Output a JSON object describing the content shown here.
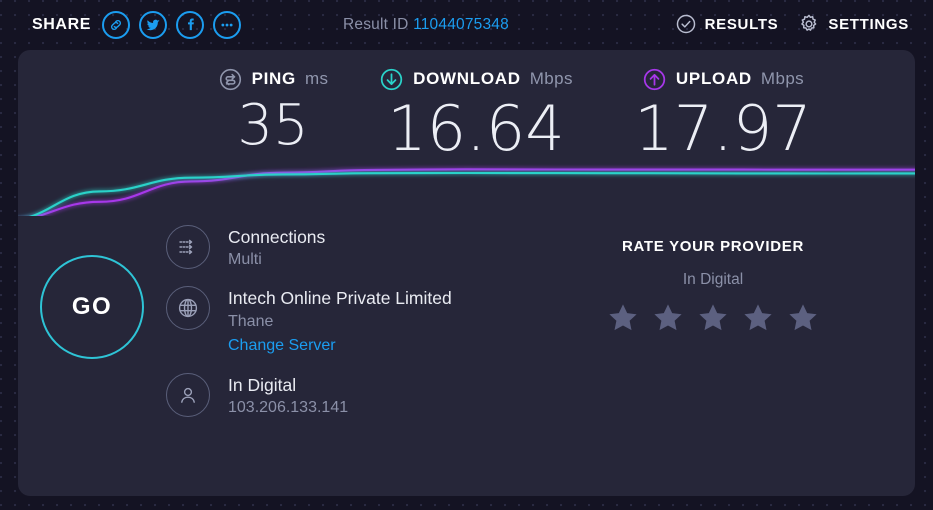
{
  "header": {
    "share_label": "SHARE",
    "share_buttons": [
      {
        "name": "link-icon",
        "title": "Copy link"
      },
      {
        "name": "twitter-icon",
        "title": "Twitter"
      },
      {
        "name": "facebook-icon",
        "title": "Facebook"
      },
      {
        "name": "more-icon",
        "title": "More"
      }
    ],
    "result_id_label": "Result ID",
    "result_id_value": "11044075348",
    "results_label": "RESULTS",
    "settings_label": "SETTINGS"
  },
  "metrics": {
    "ping": {
      "name": "PING",
      "unit": "ms",
      "value": "35",
      "icon": "ping-icon",
      "color": "#9096ad"
    },
    "download": {
      "name": "DOWNLOAD",
      "unit": "Mbps",
      "value": "16.64",
      "icon": "download-icon",
      "color": "#2ad2c9"
    },
    "upload": {
      "name": "UPLOAD",
      "unit": "Mbps",
      "value": "17.97",
      "icon": "upload-icon",
      "color": "#a737ea"
    }
  },
  "chart_data": {
    "type": "line",
    "title": "",
    "xlabel": "",
    "ylabel": "",
    "grid": false,
    "legend": "none",
    "series": [
      {
        "name": "Download",
        "color": "#2ad2c9",
        "values": [
          0,
          10.2,
          15.1,
          16.3,
          16.7,
          16.8,
          16.75,
          16.7,
          16.65,
          16.6,
          16.64
        ]
      },
      {
        "name": "Upload",
        "color": "#a737ea",
        "values": [
          0,
          6.5,
          13.8,
          16.9,
          17.9,
          18.1,
          18.05,
          18.0,
          17.99,
          17.98,
          17.97
        ]
      }
    ],
    "x": [
      0,
      1,
      2,
      3,
      4,
      5,
      6,
      7,
      8,
      9,
      10
    ],
    "ylim": [
      0,
      20
    ]
  },
  "test": {
    "go_label": "GO"
  },
  "connection": {
    "rows": [
      {
        "icon": "connections-icon",
        "title": "Connections",
        "sub": "Multi",
        "link": ""
      },
      {
        "icon": "globe-icon",
        "title": "Intech Online Private Limited",
        "sub": "Thane",
        "link": "Change Server"
      },
      {
        "icon": "person-icon",
        "title": "In Digital",
        "sub": "103.206.133.141",
        "link": ""
      }
    ]
  },
  "rating": {
    "title": "RATE YOUR PROVIDER",
    "provider": "In Digital",
    "stars_total": 5,
    "stars_filled": 0
  },
  "colors": {
    "page_bg": "#141323",
    "panel_bg": "#262639",
    "accent_blue": "#1b9df0",
    "download_cyan": "#2ad2c9",
    "upload_purple": "#a737ea",
    "go_border": "#2ec4d6"
  }
}
